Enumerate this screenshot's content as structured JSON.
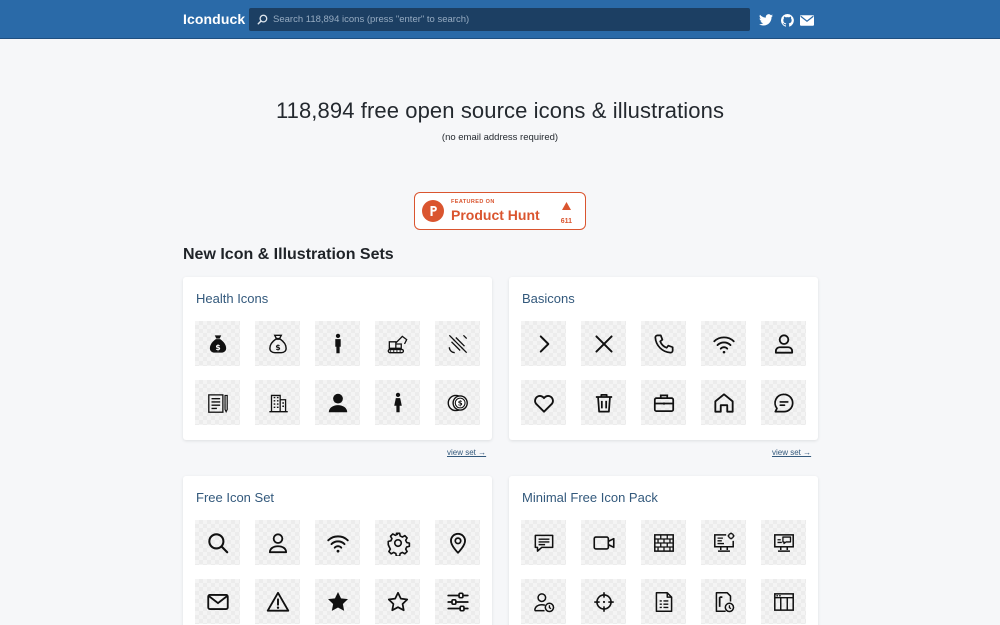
{
  "header": {
    "brand": "Iconduck",
    "search_placeholder": "Search 118,894 icons (press \"enter\" to search)",
    "social_icons": [
      "twitter-icon",
      "github-icon",
      "mail-icon"
    ]
  },
  "hero": {
    "title": "118,894 free open source icons & illustrations",
    "subtitle": "(no email address required)"
  },
  "product_hunt": {
    "featured_label": "FEATURED ON",
    "name": "Product Hunt",
    "votes": "611",
    "color": "#da552f"
  },
  "section": {
    "title": "New Icon & Illustration Sets"
  },
  "sets": [
    {
      "title": "Health Icons",
      "view_label": "view set →",
      "icons": [
        "money-bag-icon",
        "money-bag-outline-icon",
        "person-standing-icon",
        "construction-vehicle-icon",
        "satellite-icon",
        "clipboard-pen-icon",
        "hospital-building-icon",
        "person-icon",
        "woman-standing-icon",
        "coins-icon"
      ]
    },
    {
      "title": "Basicons",
      "view_label": "view set →",
      "icons": [
        "chevron-right-icon",
        "close-icon",
        "phone-icon",
        "wifi-icon",
        "user-icon",
        "heart-icon",
        "trash-icon",
        "briefcase-icon",
        "home-icon",
        "chat-bubble-icon"
      ]
    },
    {
      "title": "Free Icon Set",
      "icons": [
        "search-icon",
        "user-icon",
        "wifi-icon",
        "gear-icon",
        "location-pin-icon",
        "mail-icon",
        "warning-icon",
        "star-filled-icon",
        "star-outline-icon",
        "sliders-icon"
      ]
    },
    {
      "title": "Minimal Free Icon Pack",
      "icons": [
        "chat-lines-icon",
        "video-camera-icon",
        "brick-wall-icon",
        "monitor-settings-icon",
        "monitor-chat-icon",
        "user-clock-icon",
        "crosshair-icon",
        "document-list-icon",
        "document-clock-icon",
        "table-layout-icon"
      ]
    }
  ],
  "colors": {
    "header_bg": "#2a6aa8",
    "search_bg": "#1c3f63",
    "card_title": "#33597c",
    "page_bg": "#f6f7f9"
  }
}
